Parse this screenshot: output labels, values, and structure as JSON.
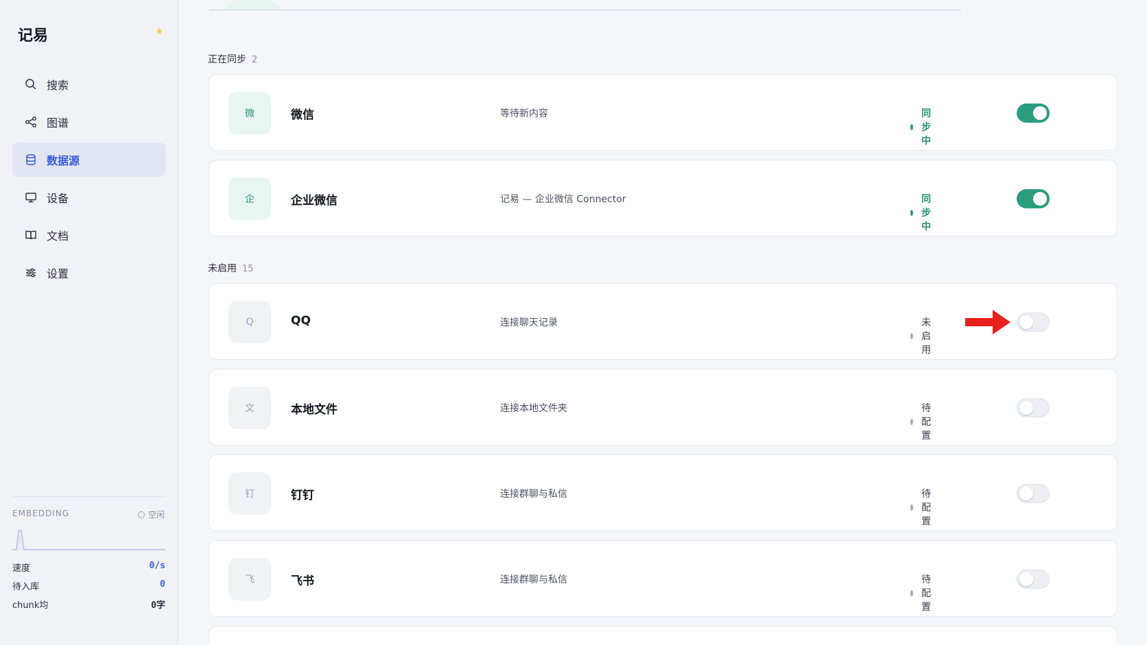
{
  "app": {
    "title": "记易"
  },
  "sidebar": {
    "items": [
      {
        "label": "搜索",
        "icon": "search-icon"
      },
      {
        "label": "图谱",
        "icon": "share-graph-icon"
      },
      {
        "label": "数据源",
        "icon": "database-icon",
        "active": true
      },
      {
        "label": "设备",
        "icon": "monitor-icon"
      },
      {
        "label": "文档",
        "icon": "book-icon"
      },
      {
        "label": "设置",
        "icon": "sliders-icon"
      }
    ],
    "embedding": {
      "title": "EMBEDDING",
      "status": "空闲",
      "stats": [
        {
          "label": "速度",
          "value": "0/s"
        },
        {
          "label": "待入库",
          "value": "0"
        },
        {
          "label": "chunk均",
          "value": "0字"
        }
      ]
    }
  },
  "sections": [
    {
      "label": "正在同步",
      "count": "2",
      "cards": [
        {
          "icon_char": "微",
          "name": "微信",
          "desc": "等待新内容",
          "status": "同步中",
          "enabled": true
        },
        {
          "icon_char": "企",
          "name": "企业微信",
          "desc": "记易 — 企业微信 Connector",
          "status": "同步中",
          "enabled": true
        }
      ]
    },
    {
      "label": "未启用",
      "count": "15",
      "cards": [
        {
          "icon_char": "Q",
          "name": "QQ",
          "desc": "连接聊天记录",
          "status": "未启用",
          "enabled": false
        },
        {
          "icon_char": "文",
          "name": "本地文件",
          "desc": "连接本地文件夹",
          "status": "待配置",
          "enabled": false
        },
        {
          "icon_char": "钉",
          "name": "钉钉",
          "desc": "连接群聊与私信",
          "status": "待配置",
          "enabled": false
        },
        {
          "icon_char": "飞",
          "name": "飞书",
          "desc": "连接群聊与私信",
          "status": "待配置",
          "enabled": false
        }
      ]
    }
  ],
  "colors": {
    "accent": "#3b5bdb",
    "sync_green": "#2a9d7f",
    "annotation_red": "#e8211c"
  }
}
